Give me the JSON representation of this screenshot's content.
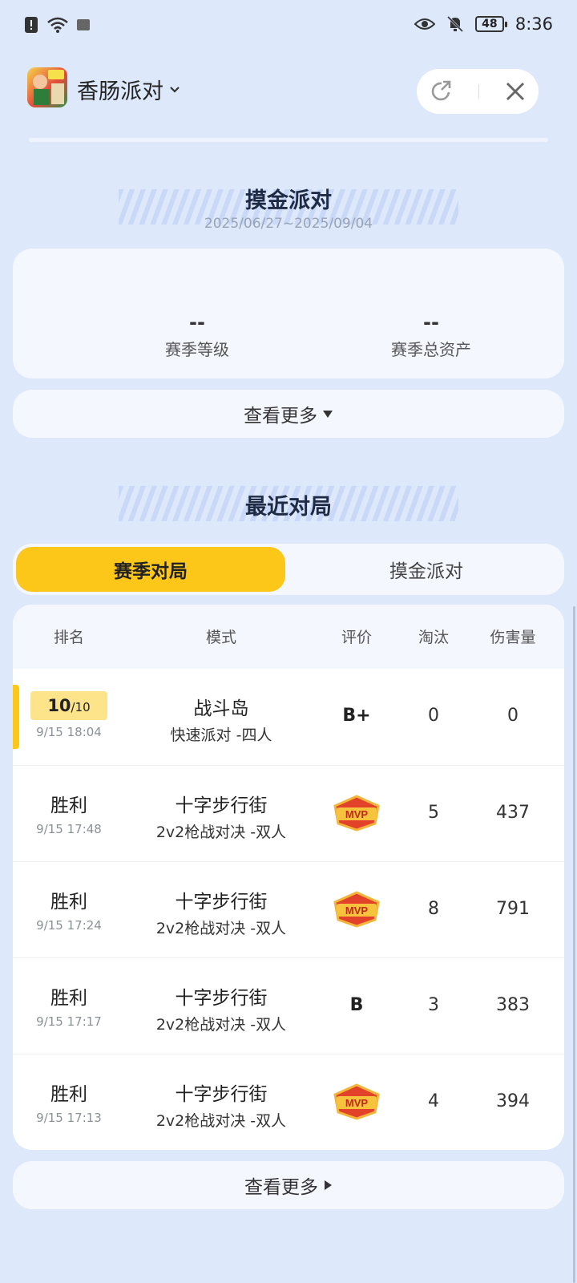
{
  "status_bar": {
    "time": "8:36",
    "battery": "48"
  },
  "header": {
    "app_name": "香肠派对"
  },
  "season": {
    "title": "摸金派对",
    "date_range": "2025/06/27~2025/09/04",
    "level_value": "--",
    "level_label": "赛季等级",
    "assets_value": "--",
    "assets_label": "赛季总资产",
    "more_label": "查看更多"
  },
  "recent": {
    "title": "最近对局",
    "tabs": [
      {
        "label": "赛季对局"
      },
      {
        "label": "摸金派对"
      }
    ],
    "columns": {
      "rank": "排名",
      "mode": "模式",
      "rating": "评价",
      "eliminations": "淘汰",
      "damage": "伤害量"
    },
    "rows": [
      {
        "rank": "10",
        "rank_total": "/10",
        "time": "9/15 18:04",
        "map": "战斗岛",
        "mode": "快速派对 -四人",
        "rating": "B+",
        "eliminations": "0",
        "damage": "0"
      },
      {
        "rank": "胜利",
        "time": "9/15 17:48",
        "map": "十字步行街",
        "mode": "2v2枪战对决 -双人",
        "rating": "MVP",
        "eliminations": "5",
        "damage": "437"
      },
      {
        "rank": "胜利",
        "time": "9/15 17:24",
        "map": "十字步行街",
        "mode": "2v2枪战对决 -双人",
        "rating": "MVP",
        "eliminations": "8",
        "damage": "791"
      },
      {
        "rank": "胜利",
        "time": "9/15 17:17",
        "map": "十字步行街",
        "mode": "2v2枪战对决 -双人",
        "rating": "B",
        "eliminations": "3",
        "damage": "383"
      },
      {
        "rank": "胜利",
        "time": "9/15 17:13",
        "map": "十字步行街",
        "mode": "2v2枪战对决 -双人",
        "rating": "MVP",
        "eliminations": "4",
        "damage": "394"
      }
    ],
    "more_label": "查看更多"
  }
}
